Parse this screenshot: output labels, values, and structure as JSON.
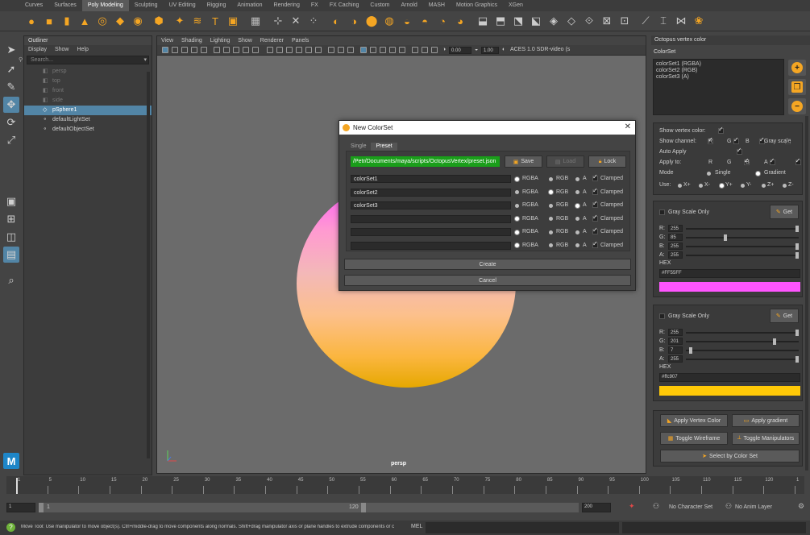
{
  "shelf": {
    "tabs": [
      "Curves",
      "Surfaces",
      "Poly Modeling",
      "Sculpting",
      "UV Editing",
      "Rigging",
      "Animation",
      "Rendering",
      "FX",
      "FX Caching",
      "Custom",
      "Arnold",
      "MASH",
      "Motion Graphics",
      "XGen"
    ],
    "active_tab": "Poly Modeling"
  },
  "outliner": {
    "title": "Outliner",
    "menu": [
      "Display",
      "Show",
      "Help"
    ],
    "search_placeholder": "Search...",
    "items": [
      {
        "label": "persp",
        "dim": true,
        "selected": false
      },
      {
        "label": "top",
        "dim": true,
        "selected": false
      },
      {
        "label": "front",
        "dim": true,
        "selected": false
      },
      {
        "label": "side",
        "dim": true,
        "selected": false
      },
      {
        "label": "pSphere1",
        "dim": false,
        "selected": true
      },
      {
        "label": "defaultLightSet",
        "dim": false,
        "selected": false
      },
      {
        "label": "defaultObjectSet",
        "dim": false,
        "selected": false
      }
    ]
  },
  "viewport": {
    "menu": [
      "View",
      "Shading",
      "Lighting",
      "Show",
      "Renderer",
      "Panels"
    ],
    "exposure": "0.00",
    "gamma": "1.00",
    "color_transform": "ACES 1.0 SDR-video (s",
    "camera_label": "persp"
  },
  "right_panel": {
    "title": "Octopus vertex color",
    "colorset_label": "ColorSet",
    "colorsets": [
      "colorSet1 (RGBA)",
      "colorSet2 (RGB)",
      "colorSet3 (A)"
    ],
    "show_vertex_color_label": "Show vertex color:",
    "show_channel_label": "Show channel:",
    "channels": [
      "R",
      "G",
      "B"
    ],
    "gray_scale_label": "Gray scale",
    "auto_apply_label": "Auto Apply",
    "apply_to_label": "Apply to:",
    "apply_channels": [
      "R",
      "G",
      "B",
      "A"
    ],
    "mode_label": "Mode",
    "mode_options": [
      "Single",
      "Gradient"
    ],
    "mode_selected": "Gradient",
    "use_label": "Use:",
    "use_options": [
      "X+",
      "X-",
      "Y+",
      "Y-",
      "Z+",
      "Z-"
    ],
    "use_selected": "Y+",
    "color_a": {
      "gray_scale_only": "Gray Scale Only",
      "get_label": "Get",
      "channels": [
        "R:",
        "G:",
        "B:",
        "A:"
      ],
      "values": [
        "255",
        "85",
        "255",
        "255"
      ],
      "hex_label": "HEX",
      "hex": "#FF55FF",
      "swatch": "#ff55ff"
    },
    "color_b": {
      "gray_scale_only": "Gray Scale Only",
      "get_label": "Get",
      "channels": [
        "R:",
        "G:",
        "B:",
        "A:"
      ],
      "values": [
        "255",
        "201",
        "7",
        "255"
      ],
      "hex_label": "HEX",
      "hex": "#ffc907",
      "swatch": "#ffc907"
    },
    "buttons": {
      "apply_vertex_color": "Apply Vertex Color",
      "apply_gradient": "Apply gradient",
      "toggle_wireframe": "Toggle Wireframe",
      "toggle_manipulators": "Toggle Manipulators",
      "select_by_color_set": "Select by Color Set"
    }
  },
  "dialog": {
    "title": "New ColorSet",
    "tabs": [
      "Single",
      "Preset"
    ],
    "active_tab": "Preset",
    "path": "/Petr/Documents/maya/scripts/OctopusVertex/preset.json",
    "save_label": "Save",
    "load_label": "Load",
    "lock_label": "Lock",
    "rows": [
      {
        "name": "colorSet1",
        "mode": "RGBA",
        "clamped": true
      },
      {
        "name": "colorSet2",
        "mode": "RGB",
        "clamped": true
      },
      {
        "name": "colorSet3",
        "mode": "A",
        "clamped": true
      },
      {
        "name": "",
        "mode": "RGBA",
        "clamped": true
      },
      {
        "name": "",
        "mode": "RGBA",
        "clamped": true
      },
      {
        "name": "",
        "mode": "RGBA",
        "clamped": true
      }
    ],
    "option_labels": [
      "RGBA",
      "RGB",
      "A"
    ],
    "clamped_label": "Clamped",
    "create_label": "Create",
    "cancel_label": "Cancel"
  },
  "timeline": {
    "ticks": [
      "1",
      "5",
      "10",
      "15",
      "20",
      "25",
      "30",
      "35",
      "40",
      "45",
      "50",
      "55",
      "60",
      "65",
      "70",
      "75",
      "80",
      "85",
      "90",
      "95",
      "100",
      "105",
      "110",
      "115",
      "120",
      "1"
    ]
  },
  "range": {
    "start": "1",
    "inner_start": "1",
    "inner_end": "120",
    "end": "200",
    "character_set": "No Character Set",
    "anim_layer": "No Anim Layer"
  },
  "help_line": {
    "text": "Move Tool: Use manipulator to move object(s). Ctrl+middle-drag to move components along normals. Shift+drag manipulator axis or plane handles to extrude components or c",
    "mel_label": "MEL"
  },
  "colors": {
    "selection": "#5285a6",
    "accent": "#f5a623",
    "path_bg": "#1a9e1a"
  }
}
